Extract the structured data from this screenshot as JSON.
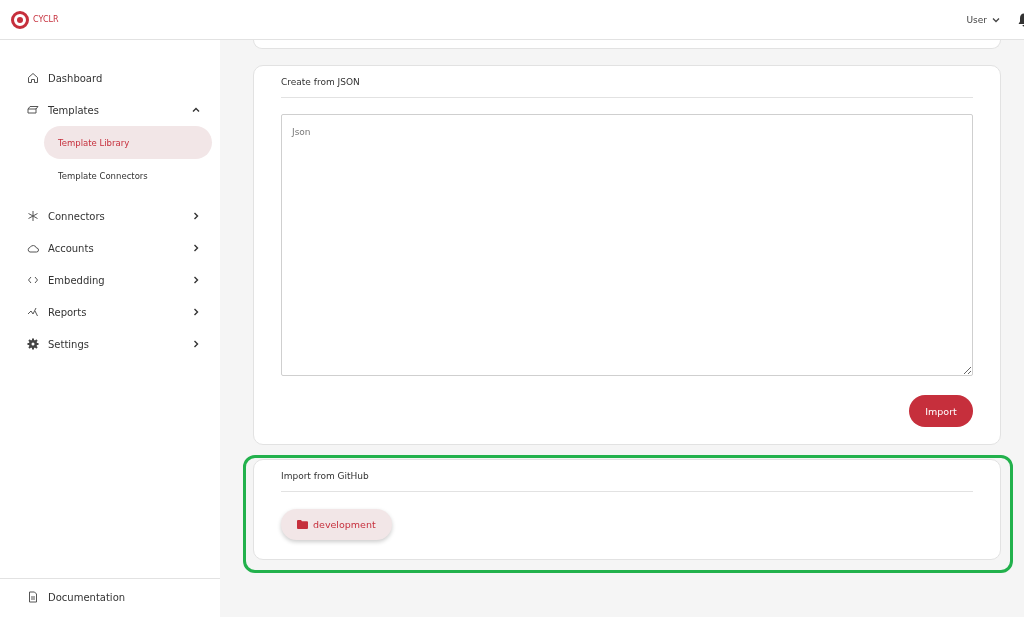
{
  "header": {
    "logo": "CYCLR",
    "user_menu": "User"
  },
  "sidebar": {
    "items": [
      {
        "kind": "home",
        "label": "Dashboard"
      },
      {
        "kind": "templates",
        "label": "Templates",
        "expanded": true,
        "children": [
          {
            "label": "Template Library",
            "selected": true
          },
          {
            "label": "Template Connectors",
            "selected": false
          }
        ]
      },
      {
        "kind": "connectors",
        "label": "Connectors",
        "expanded": false
      },
      {
        "kind": "cloud",
        "label": "Accounts",
        "expanded": false
      },
      {
        "kind": "code",
        "label": "Embedding",
        "expanded": false
      },
      {
        "kind": "reports",
        "label": "Reports",
        "expanded": false
      },
      {
        "kind": "gear",
        "label": "Settings",
        "expanded": false
      }
    ],
    "footer": {
      "kind": "doc",
      "label": "Documentation"
    }
  },
  "json_card": {
    "title": "Create from JSON",
    "placeholder": "Json",
    "button": "Import"
  },
  "github_card": {
    "title": "Import from GitHub",
    "highlighted": true,
    "folders": [
      "development"
    ]
  }
}
